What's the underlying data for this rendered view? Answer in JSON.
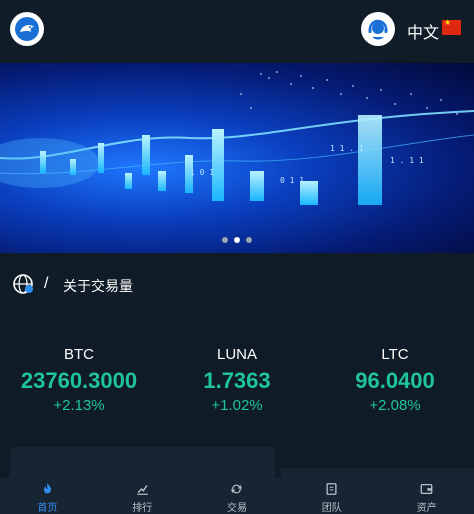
{
  "header": {
    "language": "中文",
    "logo_icon": "dolphin-logo-icon",
    "support_icon": "customer-service-icon",
    "flag_icon": "china-flag-icon"
  },
  "banner": {
    "slide_count": 3,
    "active_slide": 2
  },
  "notice": {
    "separator": "/",
    "text": "关于交易量"
  },
  "tickers": [
    {
      "symbol": "BTC",
      "price": "23760.3000",
      "change": "+2.13%"
    },
    {
      "symbol": "LUNA",
      "price": "1.7363",
      "change": "+1.02%"
    },
    {
      "symbol": "LTC",
      "price": "96.0400",
      "change": "+2.08%"
    }
  ],
  "nav": [
    {
      "label": "首页",
      "icon": "flame-icon",
      "active": true
    },
    {
      "label": "排行",
      "icon": "ranking-icon",
      "active": false
    },
    {
      "label": "交易",
      "icon": "exchange-icon",
      "active": false
    },
    {
      "label": "团队",
      "icon": "team-icon",
      "active": false
    },
    {
      "label": "资产",
      "icon": "wallet-icon",
      "active": false
    }
  ],
  "colors": {
    "accent": "#1fc498",
    "nav_active": "#2f8ff0",
    "background": "#0f1b26"
  }
}
